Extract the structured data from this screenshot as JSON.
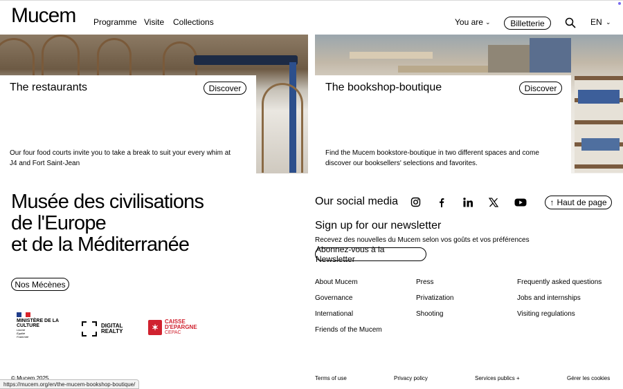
{
  "header": {
    "logo": "Mucem",
    "nav": [
      "Programme",
      "Visite",
      "Collections"
    ],
    "you_are": "You are",
    "tickets_button": "Billetterie",
    "language": "EN"
  },
  "cards": [
    {
      "title": "The restaurants",
      "button": "Discover",
      "text": "Our four food courts invite you to take a break to suit your every whim at J4 and Fort Saint-Jean"
    },
    {
      "title": "The bookshop-boutique",
      "button": "Discover",
      "text": "Find the Mucem bookstore-boutique in two different spaces and come discover our booksellers' selections and favorites."
    }
  ],
  "footer": {
    "museum_name": [
      "Musée des civilisations",
      "de l'Europe",
      "et de la Méditerranée"
    ],
    "patrons_button": "Nos Mécènes",
    "logos": {
      "ministere": {
        "name": "MINISTÈRE DE LA CULTURE",
        "motto": [
          "Liberté",
          "Égalité",
          "Fraternité"
        ]
      },
      "digital_realty": "DIGITAL REALTY",
      "caisse_epargne": {
        "name": "CAISSE D'EPARGNE",
        "sub": "CEPAC"
      }
    },
    "copyright": "© Mucem 2025",
    "social_title": "Our social media",
    "social_icons": [
      "instagram-icon",
      "facebook-icon",
      "linkedin-icon",
      "x-icon",
      "youtube-icon"
    ],
    "back_to_top": "Haut de page",
    "newsletter_title": "Sign up for our newsletter",
    "newsletter_text": "Recevez des nouvelles du Mucem selon vos goûts et vos préférences",
    "newsletter_button": "Abonnez-vous à la Newsletter",
    "links": {
      "col1": [
        "About Mucem",
        "Governance",
        "International",
        "Friends of the Mucem"
      ],
      "col2": [
        "Press",
        "Privatization",
        "Shooting"
      ],
      "col3": [
        "Frequently asked questions",
        "Jobs and internships",
        "Visiting regulations"
      ]
    },
    "legal": [
      "Terms of use",
      "Privacy policy",
      "Services publics +",
      "Gérer les cookies"
    ]
  },
  "status_url": "https://mucem.org/en/the-mucem-bookshop-boutique/",
  "colors": {
    "caisse_red": "#d0222f",
    "accent_dot": "#7b6cf0"
  }
}
